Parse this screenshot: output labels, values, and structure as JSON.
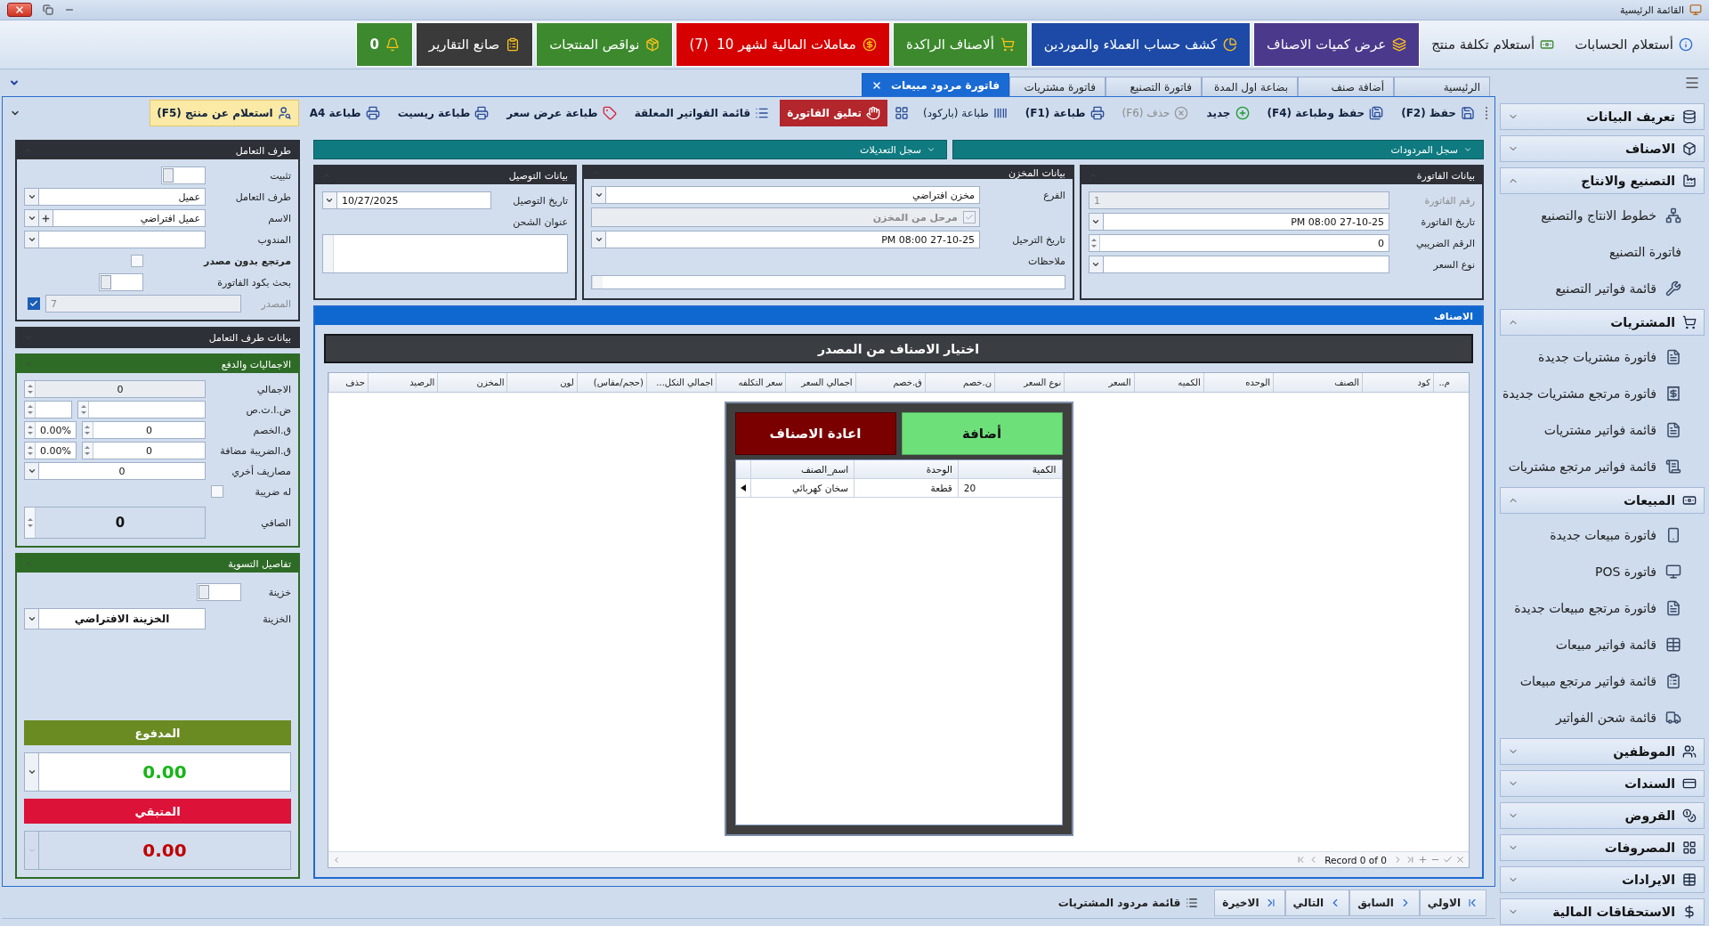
{
  "window": {
    "title": "القائمة الرئيسية"
  },
  "quick_bar": [
    {
      "label": "أستعلام الحسابات",
      "kind": "plain"
    },
    {
      "label": "أستعلام تكلفة منتج",
      "kind": "plain"
    },
    {
      "label": "عرض كميات الاصناف",
      "kind": "tile",
      "color": "#4b3a8c"
    },
    {
      "label": "كشف حساب العملاء والموردين",
      "kind": "tile",
      "color": "#1c4aa6"
    },
    {
      "label": "ألاصناف الراكدة",
      "kind": "tile",
      "color": "#3d8a2e"
    },
    {
      "label": "معاملات المالية لشهر 10  (7)",
      "kind": "tile",
      "color": "#d60000"
    },
    {
      "label": "نواقص المنتجات",
      "kind": "tile",
      "color": "#3d8a2e"
    },
    {
      "label": "صانع التقارير",
      "kind": "tile",
      "color": "#3a3a3a"
    },
    {
      "label": "0",
      "kind": "bell",
      "color": "#3d8a2e"
    }
  ],
  "tabs": [
    {
      "label": "الرئيسية",
      "selected": false
    },
    {
      "label": "أضافة صنف",
      "selected": false
    },
    {
      "label": "بضاعة اول المدة",
      "selected": false
    },
    {
      "label": "فاتورة التصنيع",
      "selected": false
    },
    {
      "label": "فاتورة مشتريات",
      "selected": false
    },
    {
      "label": "فاتورة مردود مبيعات",
      "selected": true
    }
  ],
  "toolbar": [
    {
      "label": "حفظ (F2)",
      "kind": "plain",
      "disabled": false
    },
    {
      "label": "حفظ وطباعة (F4)",
      "kind": "plain",
      "disabled": false
    },
    {
      "label": "جديد",
      "kind": "plain",
      "disabled": false
    },
    {
      "label": "حذف (F6)",
      "kind": "plain",
      "disabled": true
    },
    {
      "label": "طباعة (F1)",
      "kind": "plain",
      "disabled": false
    },
    {
      "label": "طباعة (باركود)",
      "kind": "light",
      "disabled": false
    },
    {
      "label": "تعليق الفاتورة",
      "kind": "danger",
      "disabled": false
    },
    {
      "label": "قائمة الفواتير المعلقة",
      "kind": "plain",
      "disabled": false
    },
    {
      "label": "طباعة عرض سعر",
      "kind": "plain",
      "disabled": false
    },
    {
      "label": "طباعة ريسيت",
      "kind": "plain",
      "disabled": false
    },
    {
      "label": "طباعة A4",
      "kind": "plain",
      "disabled": false
    },
    {
      "label": "استعلام عن منتج (F5)",
      "kind": "highlight",
      "disabled": false
    }
  ],
  "party": {
    "title": "طرف التعامل",
    "pin": {
      "label": "تثبيت",
      "on": false
    },
    "party_type": {
      "label": "طرف التعامل",
      "value": "عميل"
    },
    "name": {
      "label": "الاسم",
      "value": "عميل افتراضي"
    },
    "rep": {
      "label": "المندوب"
    },
    "no_source": {
      "label": "مرتجع بدون مصدر",
      "checked": false
    },
    "search_by_code": {
      "label": "بحث بكود الفاتورة",
      "on": false
    },
    "source": {
      "label": "المصدر",
      "value": "7",
      "checked": true
    }
  },
  "party_details": {
    "title": "بيانات طرف التعامل",
    "expanded": false
  },
  "totals": {
    "title": "الاجماليات والدفع",
    "total": {
      "label": "الاجمالي",
      "value": "0"
    },
    "withholding": {
      "label": "ض.ا.ت.ص"
    },
    "discount": {
      "label": "ق.الخصم",
      "value": "0",
      "percent": "0.00%"
    },
    "vat": {
      "label": "ق.الضريبة مضافة",
      "value": "0",
      "percent": "0.00%"
    },
    "other_costs": {
      "label": "مصاريف أخري",
      "value": "0"
    },
    "taxable": {
      "label": "له ضريبة",
      "checked": false
    },
    "net": {
      "label": "الصافي",
      "value": "0"
    }
  },
  "settlement": {
    "title": "تفاصيل التسوية",
    "safe_toggle": {
      "label": "خزينة",
      "on": false
    },
    "safe": {
      "label": "الخزينة",
      "value": "الخزينة الافتراضي"
    },
    "paid": {
      "label": "المدفوع",
      "value": "0.00"
    },
    "remaining": {
      "label": "المتبقي",
      "value": "0.00"
    }
  },
  "log_bars": [
    "سجل المردودات",
    "سجل التعديلات"
  ],
  "invoice": {
    "title": "بيانات الفاتورة",
    "number": {
      "label": "رقم الفاتورة",
      "value": "1"
    },
    "date": {
      "label": "تاريخ الفاتورة",
      "value": "27-10-25 08:00 PM"
    },
    "tax_no": {
      "label": "الرقم الضريبي",
      "value": "0"
    },
    "price_type": {
      "label": "نوع السعر"
    }
  },
  "store": {
    "title": "بيانات المخزن",
    "branch": {
      "label": "الفرع",
      "value": "مخزن افتراضي"
    },
    "posted": {
      "label": "مرحل من المخزن",
      "checked": true
    },
    "post_date": {
      "label": "تاريخ الترحيل",
      "value": "27-10-25 08:00 PM"
    },
    "notes": {
      "label": "ملاحظات"
    }
  },
  "delivery": {
    "title": "بيانات التوصيل",
    "date": {
      "label": "تاريخ التوصيل",
      "value": "10/27/2025"
    },
    "address": {
      "label": "عنوان الشحن"
    }
  },
  "items": {
    "title": "الاصناف",
    "picker_title": "اختيار الاصناف من المصدر",
    "columns": [
      "م..",
      "كود",
      "الصنف",
      "الوحده",
      "الكميه",
      "السعر",
      "نوع السعر",
      "ن.خصم",
      "ق.خصم",
      "اجمالي السعر",
      "سعر التكلفه",
      "اجمالي التكل...",
      "(حجم/مقاس)",
      "لون",
      "المخزن",
      "الرصيد",
      "حذف"
    ],
    "record_text": "Record 0 of 0"
  },
  "picker": {
    "add_label": "أضافة",
    "reset_label": "اعادة الاصناف",
    "columns": [
      "الكمية",
      "الوحدة",
      "اسم_الصنف"
    ],
    "rows": [
      [
        "20",
        "قطعة",
        "سخان كهربائي"
      ]
    ]
  },
  "bottom_nav": [
    "الاولي",
    "السابق",
    "التالي",
    "الاخيرة",
    "قائمة مردود المشتريات"
  ],
  "sidebar": [
    {
      "label": "تعريف البيانات",
      "expanded": false
    },
    {
      "label": "الاصناف",
      "expanded": false
    },
    {
      "label": "التصنيع والانتاج",
      "expanded": true,
      "children": [
        {
          "label": "خطوط الانتاج والتصنيع"
        },
        {
          "label": "فاتورة التصنيع"
        },
        {
          "label": "قائمة فواتير التصنيع"
        }
      ]
    },
    {
      "label": "المشتريات",
      "expanded": true,
      "children": [
        {
          "label": "فاتورة مشتريات جديدة"
        },
        {
          "label": "فاتورة مرتجع مشتريات جديدة"
        },
        {
          "label": "قائمة فواتير مشتريات"
        },
        {
          "label": "قائمة فواتير مرتجع مشتريات"
        }
      ]
    },
    {
      "label": "المبيعات",
      "expanded": true,
      "children": [
        {
          "label": "فاتورة مبيعات جديدة"
        },
        {
          "label": "فاتورة POS"
        },
        {
          "label": "فاتورة مرتجع مبيعات جديدة"
        },
        {
          "label": "قائمة فواتير مبيعات"
        },
        {
          "label": "قائمة فواتير مرتجع مبيعات"
        },
        {
          "label": "قائمة شحن الفواتير"
        }
      ]
    },
    {
      "label": "الموظفين",
      "expanded": false
    },
    {
      "label": "السندات",
      "expanded": false
    },
    {
      "label": "القروض",
      "expanded": false
    },
    {
      "label": "المصروفات",
      "expanded": false
    },
    {
      "label": "الايرادات",
      "expanded": false
    },
    {
      "label": "الاستحقاقات المالية",
      "expanded": false
    }
  ]
}
